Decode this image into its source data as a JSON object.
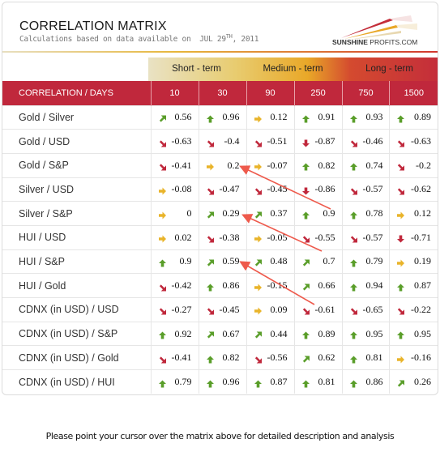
{
  "header": {
    "title": "CORRELATION MATRIX",
    "subtitle_prefix": "Calculations based on data available on",
    "date_month_day": "JUL 29",
    "date_suffix": "TH",
    "date_year": ", 2011",
    "logo_bold": "SUNSHINE",
    "logo_rest": " PROFITS.COM"
  },
  "term_bands": [
    "Short - term",
    "Medium - term",
    "Long - term"
  ],
  "table": {
    "corner_header": "CORRELATION / DAYS",
    "days": [
      "10",
      "30",
      "90",
      "250",
      "750",
      "1500"
    ],
    "rows": [
      {
        "pair": "Gold / Silver",
        "cells": [
          {
            "v": "0.56",
            "t": "diag-up"
          },
          {
            "v": "0.96",
            "t": "up"
          },
          {
            "v": "0.12",
            "t": "right"
          },
          {
            "v": "0.91",
            "t": "up"
          },
          {
            "v": "0.93",
            "t": "up"
          },
          {
            "v": "0.89",
            "t": "up"
          }
        ]
      },
      {
        "pair": "Gold / USD",
        "cells": [
          {
            "v": "-0.63",
            "t": "diag-down"
          },
          {
            "v": "-0.4",
            "t": "diag-down"
          },
          {
            "v": "-0.51",
            "t": "diag-down"
          },
          {
            "v": "-0.87",
            "t": "down"
          },
          {
            "v": "-0.46",
            "t": "diag-down"
          },
          {
            "v": "-0.63",
            "t": "diag-down"
          }
        ]
      },
      {
        "pair": "Gold / S&P",
        "cells": [
          {
            "v": "-0.41",
            "t": "diag-down"
          },
          {
            "v": "0.2",
            "t": "right"
          },
          {
            "v": "-0.07",
            "t": "right"
          },
          {
            "v": "0.82",
            "t": "up"
          },
          {
            "v": "0.74",
            "t": "up"
          },
          {
            "v": "-0.2",
            "t": "diag-down"
          }
        ]
      },
      {
        "pair": "Silver / USD",
        "cells": [
          {
            "v": "-0.08",
            "t": "right"
          },
          {
            "v": "-0.47",
            "t": "diag-down"
          },
          {
            "v": "-0.45",
            "t": "diag-down"
          },
          {
            "v": "-0.86",
            "t": "down"
          },
          {
            "v": "-0.57",
            "t": "diag-down"
          },
          {
            "v": "-0.62",
            "t": "diag-down"
          }
        ]
      },
      {
        "pair": "Silver / S&P",
        "cells": [
          {
            "v": "0",
            "t": "right"
          },
          {
            "v": "0.29",
            "t": "diag-up"
          },
          {
            "v": "0.37",
            "t": "diag-up"
          },
          {
            "v": "0.9",
            "t": "up"
          },
          {
            "v": "0.78",
            "t": "up"
          },
          {
            "v": "0.12",
            "t": "right"
          }
        ]
      },
      {
        "pair": "HUI / USD",
        "cells": [
          {
            "v": "0.02",
            "t": "right"
          },
          {
            "v": "-0.38",
            "t": "diag-down"
          },
          {
            "v": "-0.05",
            "t": "right"
          },
          {
            "v": "-0.55",
            "t": "diag-down"
          },
          {
            "v": "-0.57",
            "t": "diag-down"
          },
          {
            "v": "-0.71",
            "t": "down"
          }
        ]
      },
      {
        "pair": "HUI / S&P",
        "cells": [
          {
            "v": "0.9",
            "t": "up"
          },
          {
            "v": "0.59",
            "t": "diag-up"
          },
          {
            "v": "0.48",
            "t": "diag-up"
          },
          {
            "v": "0.7",
            "t": "diag-up"
          },
          {
            "v": "0.79",
            "t": "up"
          },
          {
            "v": "0.19",
            "t": "right"
          }
        ]
      },
      {
        "pair": "HUI / Gold",
        "cells": [
          {
            "v": "-0.42",
            "t": "diag-down"
          },
          {
            "v": "0.86",
            "t": "up"
          },
          {
            "v": "-0.15",
            "t": "right"
          },
          {
            "v": "0.66",
            "t": "diag-up"
          },
          {
            "v": "0.94",
            "t": "up"
          },
          {
            "v": "0.87",
            "t": "up"
          }
        ]
      },
      {
        "pair": "CDNX (in USD) / USD",
        "cells": [
          {
            "v": "-0.27",
            "t": "diag-down"
          },
          {
            "v": "-0.45",
            "t": "diag-down"
          },
          {
            "v": "0.09",
            "t": "right"
          },
          {
            "v": "-0.61",
            "t": "diag-down"
          },
          {
            "v": "-0.65",
            "t": "diag-down"
          },
          {
            "v": "-0.22",
            "t": "diag-down"
          }
        ]
      },
      {
        "pair": "CDNX (in USD) / S&P",
        "cells": [
          {
            "v": "0.92",
            "t": "up"
          },
          {
            "v": "0.67",
            "t": "diag-up"
          },
          {
            "v": "0.44",
            "t": "diag-up"
          },
          {
            "v": "0.89",
            "t": "up"
          },
          {
            "v": "0.95",
            "t": "up"
          },
          {
            "v": "0.95",
            "t": "up"
          }
        ]
      },
      {
        "pair": "CDNX (in USD) / Gold",
        "cells": [
          {
            "v": "-0.41",
            "t": "diag-down"
          },
          {
            "v": "0.82",
            "t": "up"
          },
          {
            "v": "-0.56",
            "t": "diag-down"
          },
          {
            "v": "0.62",
            "t": "diag-up"
          },
          {
            "v": "0.81",
            "t": "up"
          },
          {
            "v": "-0.16",
            "t": "right"
          }
        ]
      },
      {
        "pair": "CDNX (in USD) / HUI",
        "cells": [
          {
            "v": "0.79",
            "t": "up"
          },
          {
            "v": "0.96",
            "t": "up"
          },
          {
            "v": "0.87",
            "t": "up"
          },
          {
            "v": "0.81",
            "t": "up"
          },
          {
            "v": "0.86",
            "t": "up"
          },
          {
            "v": "0.26",
            "t": "diag-up"
          }
        ]
      }
    ]
  },
  "annotations": [
    {
      "from_cell": "Silver / S&P @ 250",
      "to_cell": "Gold / S&P @ 30"
    },
    {
      "from_cell": "HUI / S&P @ 250",
      "to_cell": "Silver / S&P @ 30"
    },
    {
      "from_cell": "CDNX (in USD) / USD @ 250",
      "to_cell": "HUI / S&P @ 30"
    }
  ],
  "colors": {
    "header_red": "#c0283c",
    "up_green": "#5a9e2a",
    "neutral_yellow": "#e9b42a",
    "down_red": "#c0283c",
    "annotation": "#ee5a4c"
  },
  "footer": "Please point your cursor over the matrix above for detailed description and analysis"
}
